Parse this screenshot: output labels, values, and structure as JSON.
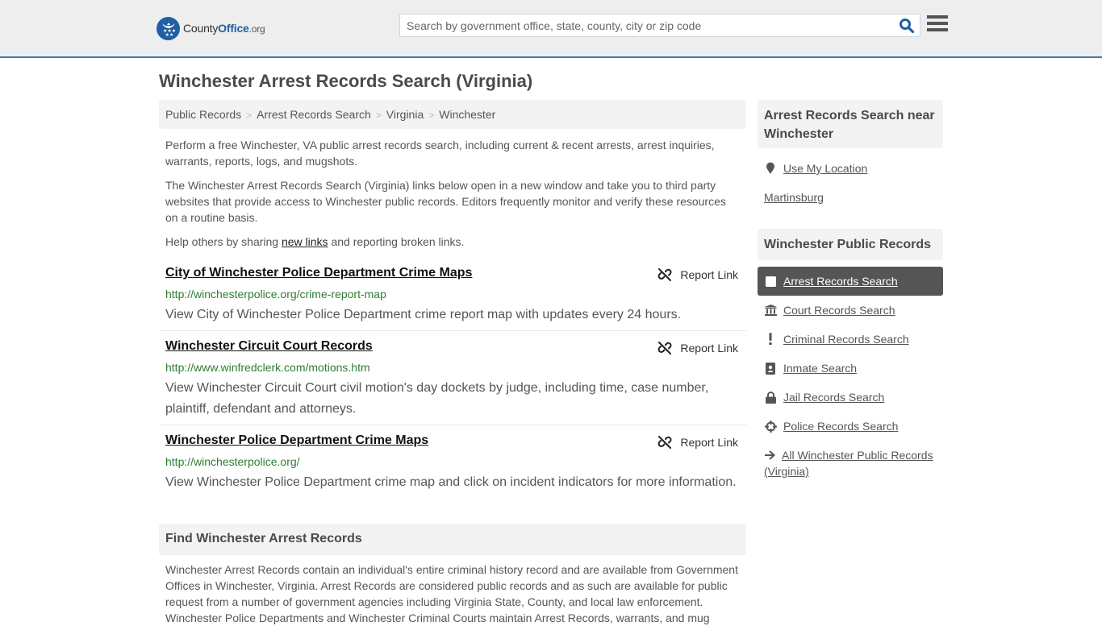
{
  "header": {
    "logo": {
      "name_part1": "County",
      "name_part2": "Office",
      "name_part3": ".org"
    },
    "search": {
      "placeholder": "Search by government office, state, county, city or zip code",
      "value": ""
    },
    "colors": {
      "brand_blue": "#1f5fa3",
      "header_border": "#3a7aad"
    }
  },
  "page": {
    "title": "Winchester Arrest Records Search (Virginia)"
  },
  "breadcrumb": [
    {
      "label": "Public Records"
    },
    {
      "label": "Arrest Records Search"
    },
    {
      "label": "Virginia"
    },
    {
      "label": "Winchester"
    }
  ],
  "breadcrumb_separator": ">",
  "intro": {
    "p1": "Perform a free Winchester, VA public arrest records search, including current & recent arrests, arrest inquiries, warrants, reports, logs, and mugshots.",
    "p2": "The Winchester Arrest Records Search (Virginia) links below open in a new window and take you to third party websites that provide access to Winchester public records. Editors frequently monitor and verify these resources on a routine basis.",
    "p3_before": "Help others by sharing ",
    "p3_link": "new links",
    "p3_after": " and reporting broken links."
  },
  "results": [
    {
      "title": "City of Winchester Police Department Crime Maps",
      "url": "http://winchesterpolice.org/crime-report-map",
      "description": "View City of Winchester Police Department crime report map with updates every 24 hours.",
      "report_label": "Report Link"
    },
    {
      "title": "Winchester Circuit Court Records",
      "url": "http://www.winfredclerk.com/motions.htm",
      "description": "View Winchester Circuit Court civil motion's day dockets by judge, including time, case number, plaintiff, defendant and attorneys.",
      "report_label": "Report Link"
    },
    {
      "title": "Winchester Police Department Crime Maps",
      "url": "http://winchesterpolice.org/",
      "description": "View Winchester Police Department crime map and click on incident indicators for more information.",
      "report_label": "Report Link"
    }
  ],
  "find_section": {
    "heading": "Find Winchester Arrest Records",
    "body": "Winchester Arrest Records contain an individual's entire criminal history record and are available from Government Offices in Winchester, Virginia. Arrest Records are considered public records and as such are available for public request from a number of government agencies including Virginia State, County, and local law enforcement. Winchester Police Departments and Winchester Criminal Courts maintain Arrest Records, warrants, and mug"
  },
  "sidebar": {
    "near": {
      "heading": "Arrest Records Search near Winchester",
      "use_location": "Use My Location",
      "places": [
        "Martinsburg"
      ]
    },
    "public_records": {
      "heading": "Winchester Public Records",
      "items": [
        {
          "label": "Arrest Records Search",
          "icon": "square-icon",
          "active": true
        },
        {
          "label": "Court Records Search",
          "icon": "courthouse-icon",
          "active": false
        },
        {
          "label": "Criminal Records Search",
          "icon": "exclamation-icon",
          "active": false
        },
        {
          "label": "Inmate Search",
          "icon": "id-badge-icon",
          "active": false
        },
        {
          "label": "Jail Records Search",
          "icon": "lock-icon",
          "active": false
        },
        {
          "label": "Police Records Search",
          "icon": "crosshairs-icon",
          "active": false
        }
      ],
      "all_link": "All Winchester Public Records (Virginia)"
    }
  }
}
